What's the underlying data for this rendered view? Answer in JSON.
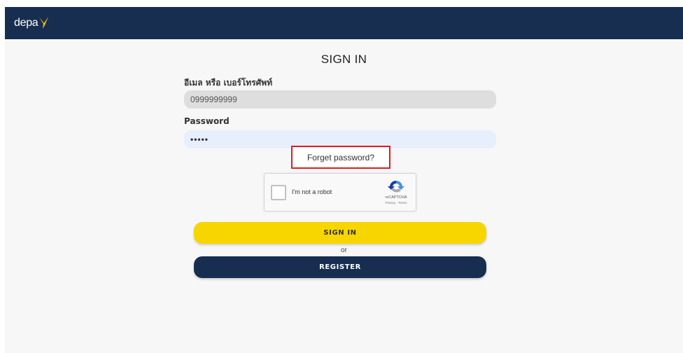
{
  "header": {
    "logo_text": "depa"
  },
  "page": {
    "title": "SIGN IN"
  },
  "form": {
    "email_label": "อีเมล หรือ เบอร์โทรศัพท์",
    "email_value": "0999999999",
    "password_label": "Password",
    "password_value": "•••••",
    "forget_password": "Forget password?"
  },
  "captcha": {
    "label": "I'm not a robot",
    "brand": "reCAPTCHA",
    "terms": "Privacy - Terms"
  },
  "actions": {
    "signin_label": "SIGN IN",
    "or_text": "or",
    "register_label": "REGISTER"
  },
  "colors": {
    "brand_navy": "#182e50",
    "brand_yellow": "#f7d600",
    "highlight_red": "#e01c1c"
  }
}
